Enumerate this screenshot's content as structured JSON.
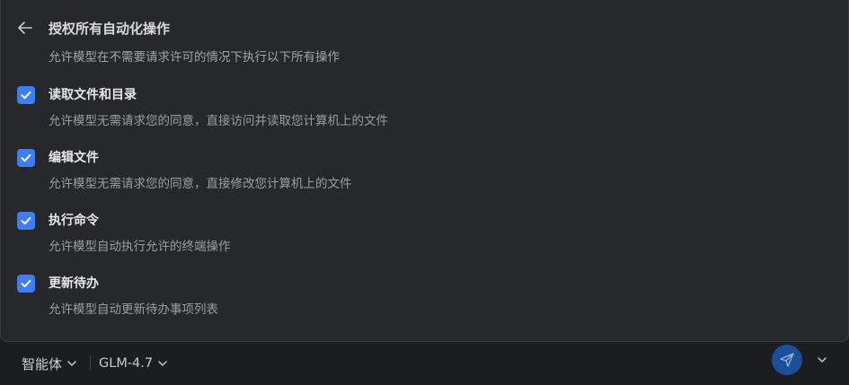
{
  "header": {
    "title": "授权所有自动化操作",
    "description": "允许模型在不需要请求许可的情况下执行以下所有操作"
  },
  "permissions": [
    {
      "title": "读取文件和目录",
      "description": "允许模型无需请求您的同意，直接访问并读取您计算机上的文件",
      "checked": true
    },
    {
      "title": "编辑文件",
      "description": "允许模型无需请求您的同意，直接修改您计算机上的文件",
      "checked": true
    },
    {
      "title": "执行命令",
      "description": "允许模型自动执行允许的终端操作",
      "checked": true
    },
    {
      "title": "更新待办",
      "description": "允许模型自动更新待办事项列表",
      "checked": true
    }
  ],
  "footer": {
    "agent_label": "智能体",
    "model_label": "GLM-4.7"
  },
  "colors": {
    "accent": "#3d7ef5",
    "send_button": "#1d4f96",
    "panel": "#27282c",
    "background": "#1c1d20"
  },
  "icons": {
    "back": "arrow-left-icon",
    "check": "check-icon",
    "dropdown": "chevron-down-icon",
    "send": "paper-plane-icon"
  }
}
